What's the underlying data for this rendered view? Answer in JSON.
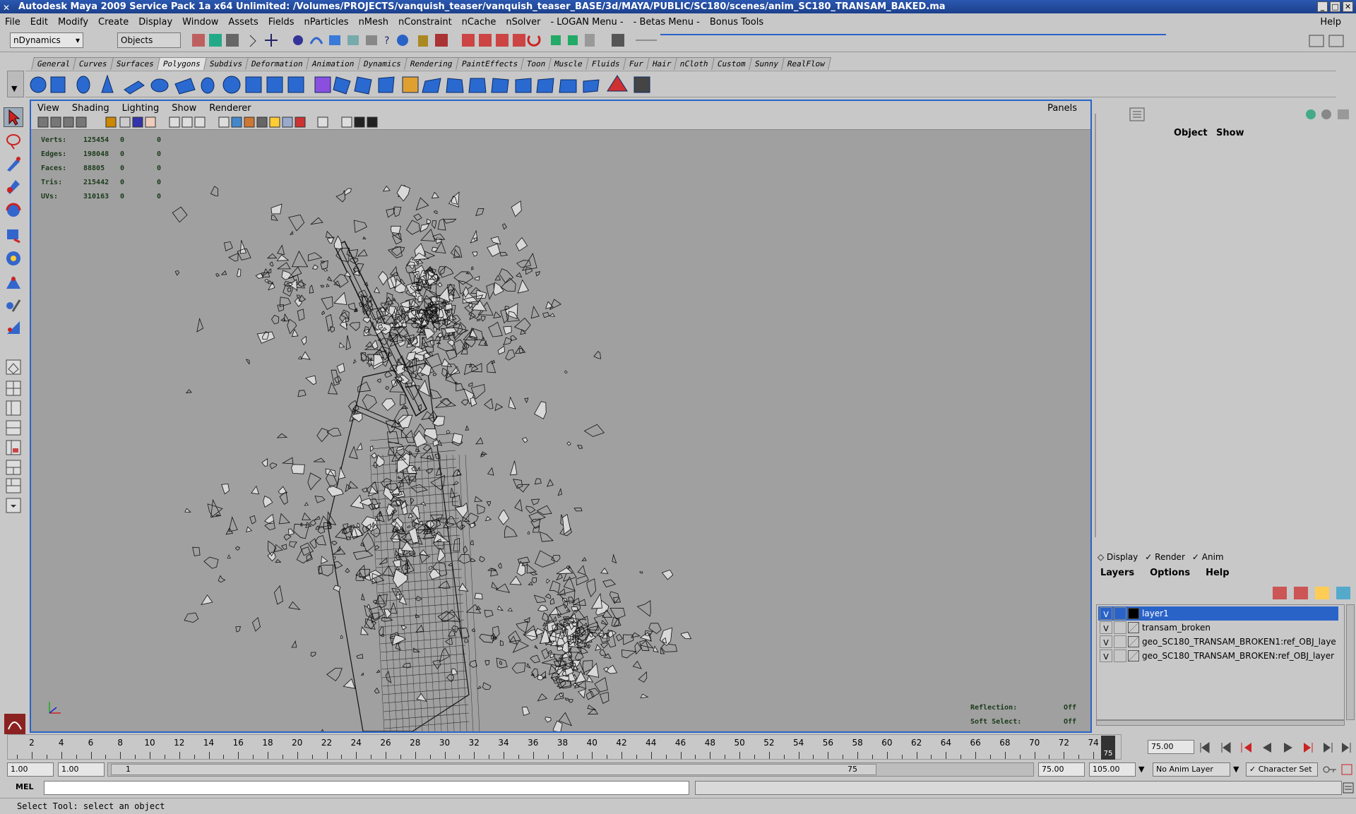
{
  "window": {
    "title": "Autodesk Maya 2009 Service Pack 1a x64 Unlimited: /Volumes/PROJECTS/vanquish_teaser/vanquish_teaser_BASE/3d/MAYA/PUBLIC/SC180/scenes/anim_SC180_TRANSAM_BAKED.ma"
  },
  "menubar": {
    "items": [
      "File",
      "Edit",
      "Modify",
      "Create",
      "Display",
      "Window",
      "Assets",
      "Fields",
      "nParticles",
      "nMesh",
      "nConstraint",
      "nCache",
      "nSolver",
      "- LOGAN Menu -",
      "- Betas Menu -",
      "Bonus Tools"
    ],
    "help": "Help"
  },
  "statusline": {
    "menuset": "nDynamics",
    "selection_mode": "Objects"
  },
  "shelf": {
    "tabs": [
      "General",
      "Curves",
      "Surfaces",
      "Polygons",
      "Subdivs",
      "Deformation",
      "Animation",
      "Dynamics",
      "Rendering",
      "PaintEffects",
      "Toon",
      "Muscle",
      "Fluids",
      "Fur",
      "Hair",
      "nCloth",
      "Custom",
      "Sunny",
      "RealFlow"
    ],
    "active_tab": "Polygons"
  },
  "viewport": {
    "menu": [
      "View",
      "Shading",
      "Lighting",
      "Show",
      "Renderer"
    ],
    "panels": "Panels",
    "hud": [
      {
        "label": "Verts:",
        "value": "125454",
        "a": "0",
        "b": "0"
      },
      {
        "label": "Edges:",
        "value": "198048",
        "a": "0",
        "b": "0"
      },
      {
        "label": "Faces:",
        "value": "88805",
        "a": "0",
        "b": "0"
      },
      {
        "label": "Tris:",
        "value": "215442",
        "a": "0",
        "b": "0"
      },
      {
        "label": "UVs:",
        "value": "310163",
        "a": "0",
        "b": "0"
      }
    ],
    "reflection_label": "Reflection:",
    "reflection_value": "Off",
    "softselect_label": "Soft Select:",
    "softselect_value": "Off"
  },
  "channelbox": {
    "object": "Object",
    "show": "Show"
  },
  "layers": {
    "modes": [
      "Display",
      "Render",
      "Anim"
    ],
    "menu": [
      "Layers",
      "Options",
      "Help"
    ],
    "rows": [
      {
        "v": "V",
        "name": "layer1",
        "selected": true
      },
      {
        "v": "V",
        "name": "transam_broken",
        "selected": false
      },
      {
        "v": "V",
        "name": "geo_SC180_TRANSAM_BROKEN1:ref_OBJ_laye",
        "selected": false
      },
      {
        "v": "V",
        "name": "geo_SC180_TRANSAM_BROKEN:ref_OBJ_layer",
        "selected": false
      }
    ]
  },
  "timeslider": {
    "labels": [
      "2",
      "4",
      "6",
      "8",
      "10",
      "12",
      "14",
      "16",
      "18",
      "20",
      "22",
      "24",
      "26",
      "28",
      "30",
      "32",
      "34",
      "36",
      "38",
      "40",
      "42",
      "44",
      "46",
      "48",
      "50",
      "52",
      "54",
      "56",
      "58",
      "60",
      "62",
      "64",
      "66",
      "68",
      "70",
      "72",
      "74"
    ],
    "current_frame": "75",
    "current_field": "75.00"
  },
  "range": {
    "start": "1.00",
    "playback_start": "1.00",
    "slider_start": "1",
    "slider_end": "75",
    "playback_end": "75.00",
    "end": "105.00",
    "anim_layer": "No Anim Layer",
    "character_set": "Character Set"
  },
  "cmdline": {
    "label": "MEL"
  },
  "helpline": {
    "text": "Select Tool: select an object"
  },
  "colors": {
    "accent": "#2a63c8",
    "viewport_bg": "#a0a0a0",
    "panel_bg": "#c8c8c8",
    "titlebar": "#1c3f8c"
  }
}
